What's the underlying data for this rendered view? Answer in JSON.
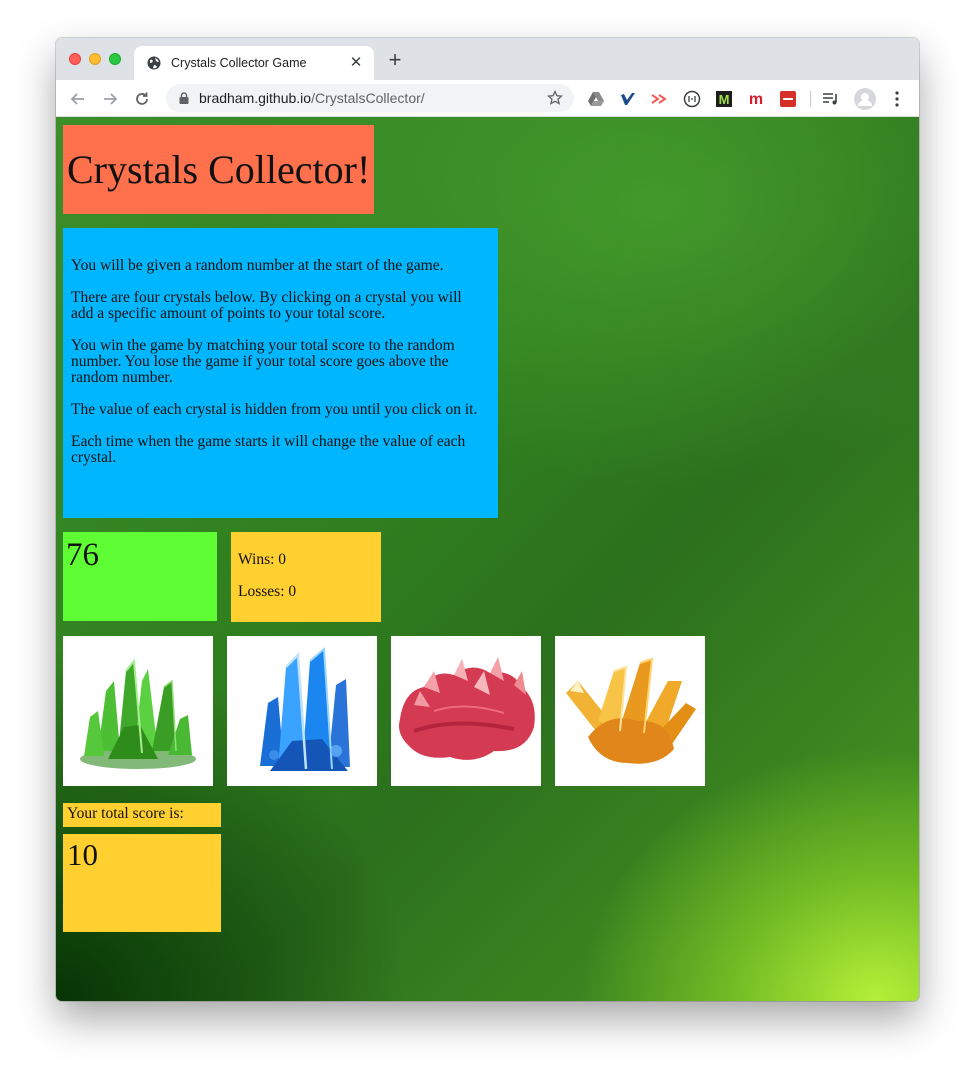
{
  "browser": {
    "tab_title": "Crystals Collector Game",
    "url_host": "bradham.github.io",
    "url_path": "/CrystalsCollector/",
    "icons": [
      "globe-icon",
      "close-icon",
      "plus-icon",
      "back-icon",
      "forward-icon",
      "reload-icon",
      "lock-icon",
      "star-icon",
      "google-drive-icon",
      "vimeo-icon",
      "cast-icon",
      "circle-icon",
      "m-green-icon",
      "m-red-icon",
      "ext-red-icon",
      "playlist-icon",
      "profile-icon",
      "menu-icon"
    ]
  },
  "game": {
    "title": "Crystals Collector!",
    "instructions": [
      "You will be given a random number at the start of the game.",
      "There are four crystals below. By clicking on a crystal you will add a specific amount of points to your total score.",
      "You win the game by matching your total score to the random number. You lose the game if your total score goes above the random number.",
      "The value of each crystal is hidden from you until you click on it.",
      "Each time when the game starts it will change the value of each crystal."
    ],
    "target_number": "76",
    "wins_text": "Wins: 0",
    "losses_text": "Losses: 0",
    "crystals": [
      {
        "name": "green-crystal",
        "color": "#3fae2a"
      },
      {
        "name": "blue-crystal",
        "color": "#1e7be0"
      },
      {
        "name": "red-crystal",
        "color": "#d8344f"
      },
      {
        "name": "orange-crystal",
        "color": "#f5a623"
      }
    ],
    "score_label": "Your total score is:",
    "total_score": "10"
  },
  "colors": {
    "header_bg": "#ff714c",
    "instructions_bg": "#00b7ff",
    "target_bg": "#5ffd33",
    "yellow_bg": "#ffd02f"
  }
}
